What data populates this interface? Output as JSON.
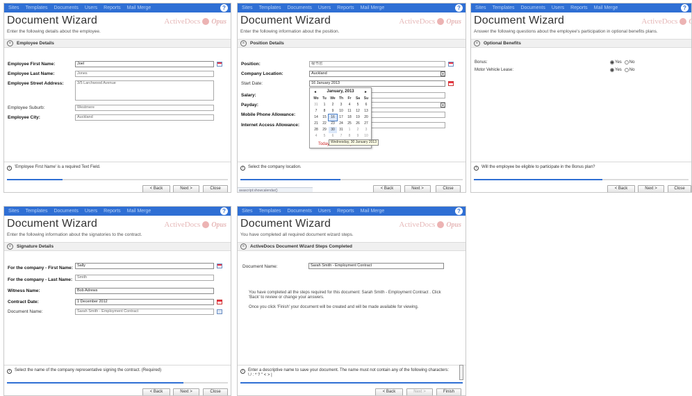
{
  "nav": {
    "sites": "Sites",
    "templates": "Templates",
    "documents": "Documents",
    "users": "Users",
    "reports": "Reports",
    "mail_merge": "Mail Merge",
    "help": "?"
  },
  "wizard_title": "Document Wizard",
  "logo": {
    "text": "ActiveDocs",
    "brand": "Opus"
  },
  "buttons": {
    "back": "< Back",
    "next": "Next >",
    "close": "Close",
    "finish": "Finish"
  },
  "panel1": {
    "subtitle": "Enter the following details about the employee.",
    "section": "Employee Details",
    "fields": [
      {
        "label": "Employee First Name:",
        "value": "Joel"
      },
      {
        "label": "Employee Last Name:",
        "value": "Jones"
      },
      {
        "label": "Employee Street Address:",
        "value": "3/5 Larchwood Avenue"
      },
      {
        "label": "Employee Suburb:",
        "value": "Westmere"
      },
      {
        "label": "Employee City:",
        "value": "Auckland"
      }
    ],
    "info": "'Employee First Name' is a required Text Field.",
    "progress": 0.25
  },
  "panel2": {
    "subtitle": "Enter the following information about the position.",
    "section": "Position Details",
    "fields": [
      {
        "label": "Position:",
        "value": "秘书官"
      },
      {
        "label": "Company Location:",
        "value": "Auckland"
      },
      {
        "label": "Start Date:",
        "value": "16 January 2013"
      },
      {
        "label": "Salary:",
        "value": ""
      },
      {
        "label": "Payday:",
        "value": ""
      },
      {
        "label": "Mobile Phone Allowance:",
        "value": ""
      },
      {
        "label": "Internet Access Allowance:",
        "value": ""
      }
    ],
    "calendar": {
      "prev": "◂",
      "next": "▸",
      "month": "January, 2013",
      "daynames": [
        "Mo",
        "Tu",
        "We",
        "Th",
        "Fr",
        "Sa",
        "Su"
      ],
      "days": [
        "31",
        "1",
        "2",
        "3",
        "4",
        "5",
        "6",
        "7",
        "8",
        "9",
        "10",
        "11",
        "12",
        "13",
        "14",
        "15",
        "16",
        "17",
        "18",
        "19",
        "20",
        "21",
        "22",
        "23",
        "24",
        "25",
        "26",
        "27",
        "28",
        "29",
        "30",
        "31",
        "1",
        "2",
        "3",
        "4",
        "5",
        "6",
        "7",
        "8",
        "9",
        "10"
      ],
      "today": "Today: 16 January 2013",
      "tooltip": "Wednesday, 30 January 2013"
    },
    "info": "Select the company location.",
    "status": "avascript:showcalendar()",
    "progress": 0.45
  },
  "panel3": {
    "subtitle": "Answer the following questions about the employee's participation in optional benefits plans.",
    "section": "Optional Benefits",
    "fields": [
      {
        "label": "Bonus:",
        "yes": "Yes",
        "no": "No"
      },
      {
        "label": "Motor Vehicle Lease:",
        "yes": "Yes",
        "no": "No"
      }
    ],
    "info": "Will the employee be eligible to participate in the Bonus plan?",
    "progress": 0.6
  },
  "panel4": {
    "subtitle": "Enter the following information about the signatories to the contract.",
    "section": "Signature Details",
    "fields": [
      {
        "label": "For the company - First Name:",
        "value": "Sally"
      },
      {
        "label": "For the company - Last Name:",
        "value": "Smith"
      },
      {
        "label": "Witness Name:",
        "value": "Bob Adrews"
      },
      {
        "label": "Contract Date:",
        "value": "1 December 2012"
      },
      {
        "label": "Document Name:",
        "value": "Sarah Smith - Employment Contract"
      }
    ],
    "info": "Select the name of the company representative signing the contract. (Required)",
    "progress": 0.8
  },
  "panel5": {
    "subtitle": "You have completed all required document wizard steps.",
    "section": "ActiveDocs Document Wizard Steps Completed",
    "doc_label": "Document Name:",
    "doc_value": "Sarah Smith - Employment Contract",
    "text1": "You have completed all the steps required for this document: Sarah Smith - Employment Contract . Click 'Back' to review or change your answers.",
    "text2": "Once you click 'Finish' your document will be created and will be made available for viewing.",
    "info": "Enter a descriptive name to save your document. The name must not contain any of the following characters:",
    "info2": "\\ / : * ? \" < > |",
    "progress": 1.0
  }
}
